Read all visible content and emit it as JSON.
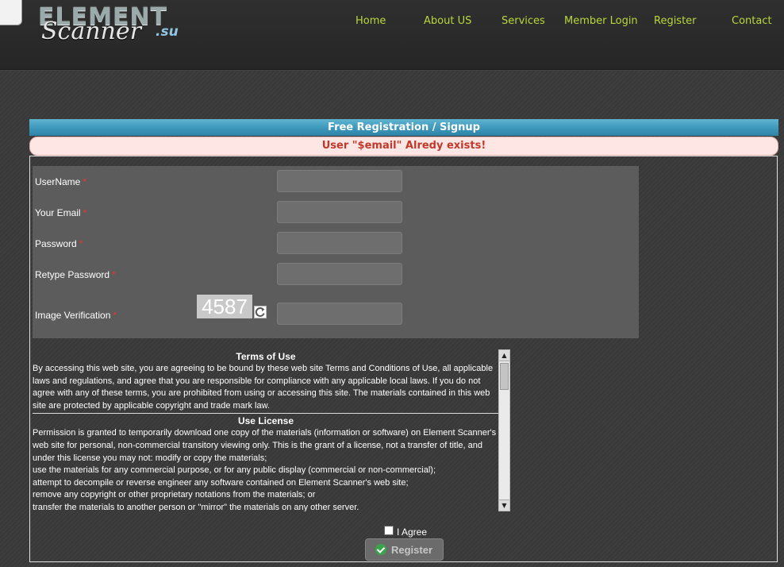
{
  "logo": {
    "line1": "ELEMENT",
    "line2": "Scanner",
    "tld": ".su"
  },
  "nav": [
    {
      "label": "Home"
    },
    {
      "label": "About US"
    },
    {
      "label": "Services"
    },
    {
      "label": "Member Login"
    },
    {
      "label": "Register"
    },
    {
      "label": "Contact"
    }
  ],
  "form": {
    "heading": "Free Registration / Signup",
    "error": "User \"$email\" Alredy exists!",
    "required_mark": "*",
    "fields": [
      {
        "label": "UserName",
        "value": ""
      },
      {
        "label": "Your Email",
        "value": ""
      },
      {
        "label": "Password",
        "value": ""
      },
      {
        "label": "Retype Password",
        "value": ""
      },
      {
        "label": "Image Verification",
        "value": ""
      }
    ],
    "captcha_code": "4587"
  },
  "terms": {
    "title": "Terms of Use",
    "body": "By accessing this web site, you are agreeing to be bound by these web site Terms and Conditions of Use, all applicable laws and regulations, and agree that you are responsible for compliance with any applicable local laws. If you do not agree with any of these terms, you are prohibited from using or accessing this site. The materials contained in this web site are protected by applicable copyright and trade mark law.",
    "license_title": "Use License",
    "license_lines": [
      "Permission is granted to temporarily download one copy of the materials (information or software) on Element Scanner's web site for personal, non-commercial transitory viewing only. This is the grant of a license, not a transfer of title, and under this license you may not: modify or copy the materials;",
      "use the materials for any commercial purpose, or for any public display (commercial or non-commercial);",
      "attempt to decompile or reverse engineer any software contained on Element Scanner's web site;",
      "remove any copyright or other proprietary notations from the materials; or",
      "transfer the materials to another person or \"mirror\" the materials on any other server."
    ]
  },
  "agree_label": "I Agree",
  "register_label": "Register",
  "colors": {
    "nav_text": "#b8d73c",
    "header_bar": "#3b95b8",
    "error_text": "#c0392b",
    "accent_check": "#3aa44a"
  },
  "icons": {
    "refresh": "refresh-icon",
    "register": "check-circle-icon"
  }
}
